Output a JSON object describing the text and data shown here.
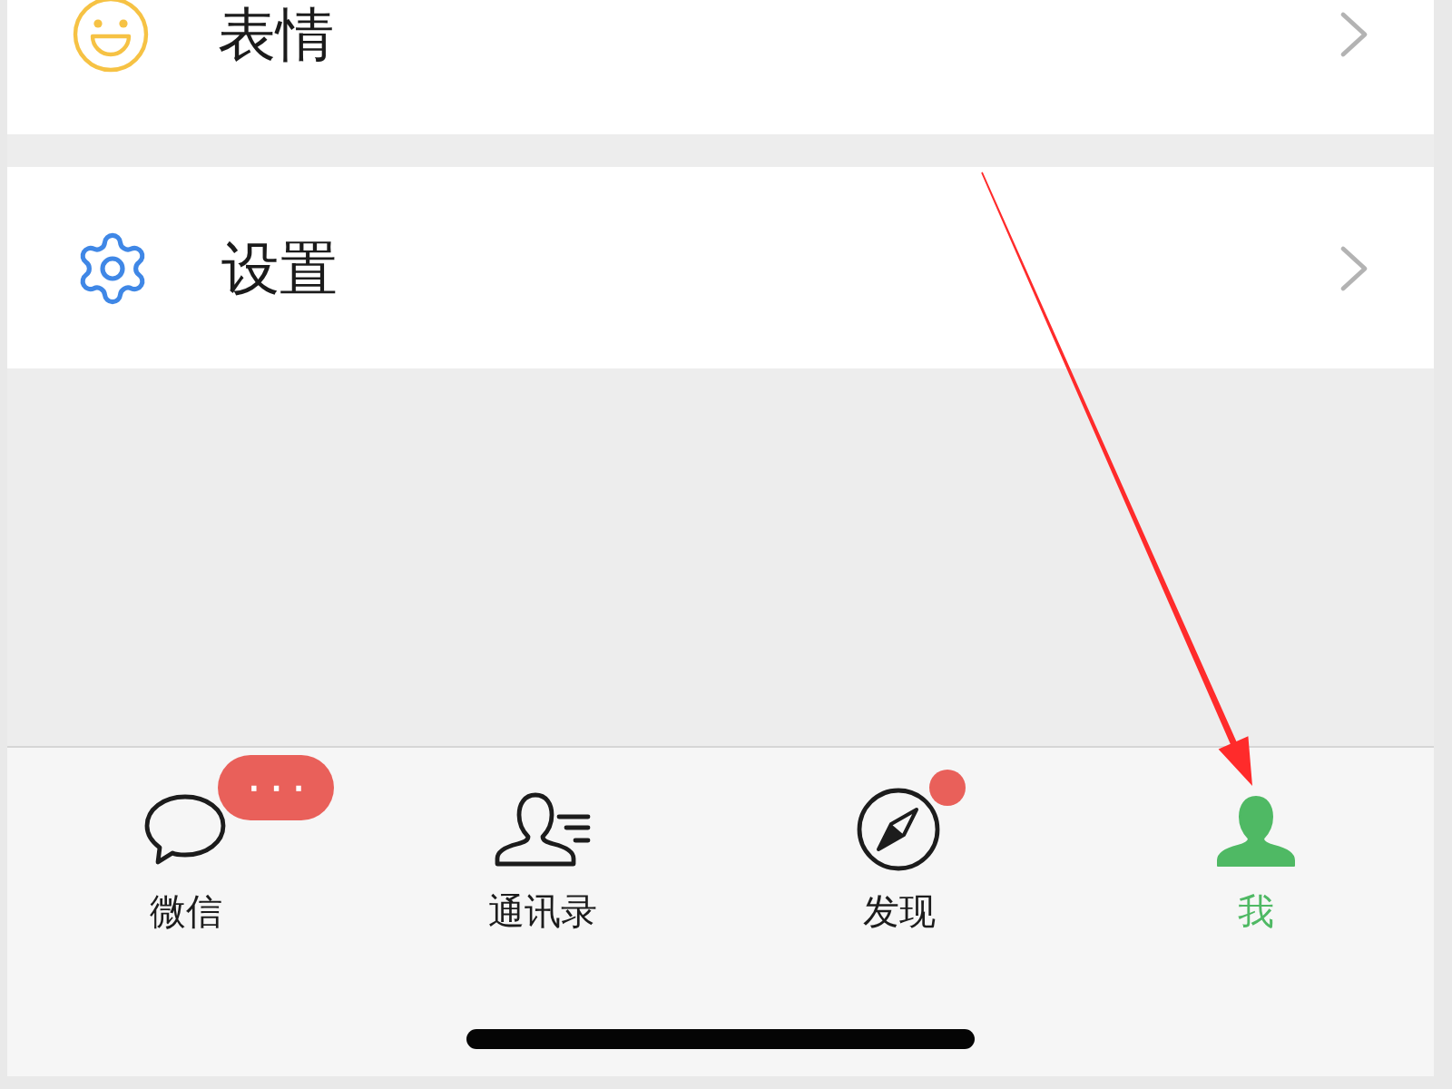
{
  "menu_groups": [
    {
      "items": [
        {
          "label": "表情"
        }
      ]
    },
    {
      "items": [
        {
          "label": "设置"
        }
      ]
    }
  ],
  "tab_bar": {
    "tabs": [
      {
        "label": "微信",
        "selected": false,
        "badge": "···",
        "dot": false
      },
      {
        "label": "通讯录",
        "selected": false,
        "dot": false
      },
      {
        "label": "发现",
        "selected": false,
        "dot": true
      },
      {
        "label": "我",
        "selected": true,
        "dot": false
      }
    ]
  },
  "annotations": [
    {
      "kind": "arrow"
    }
  ]
}
